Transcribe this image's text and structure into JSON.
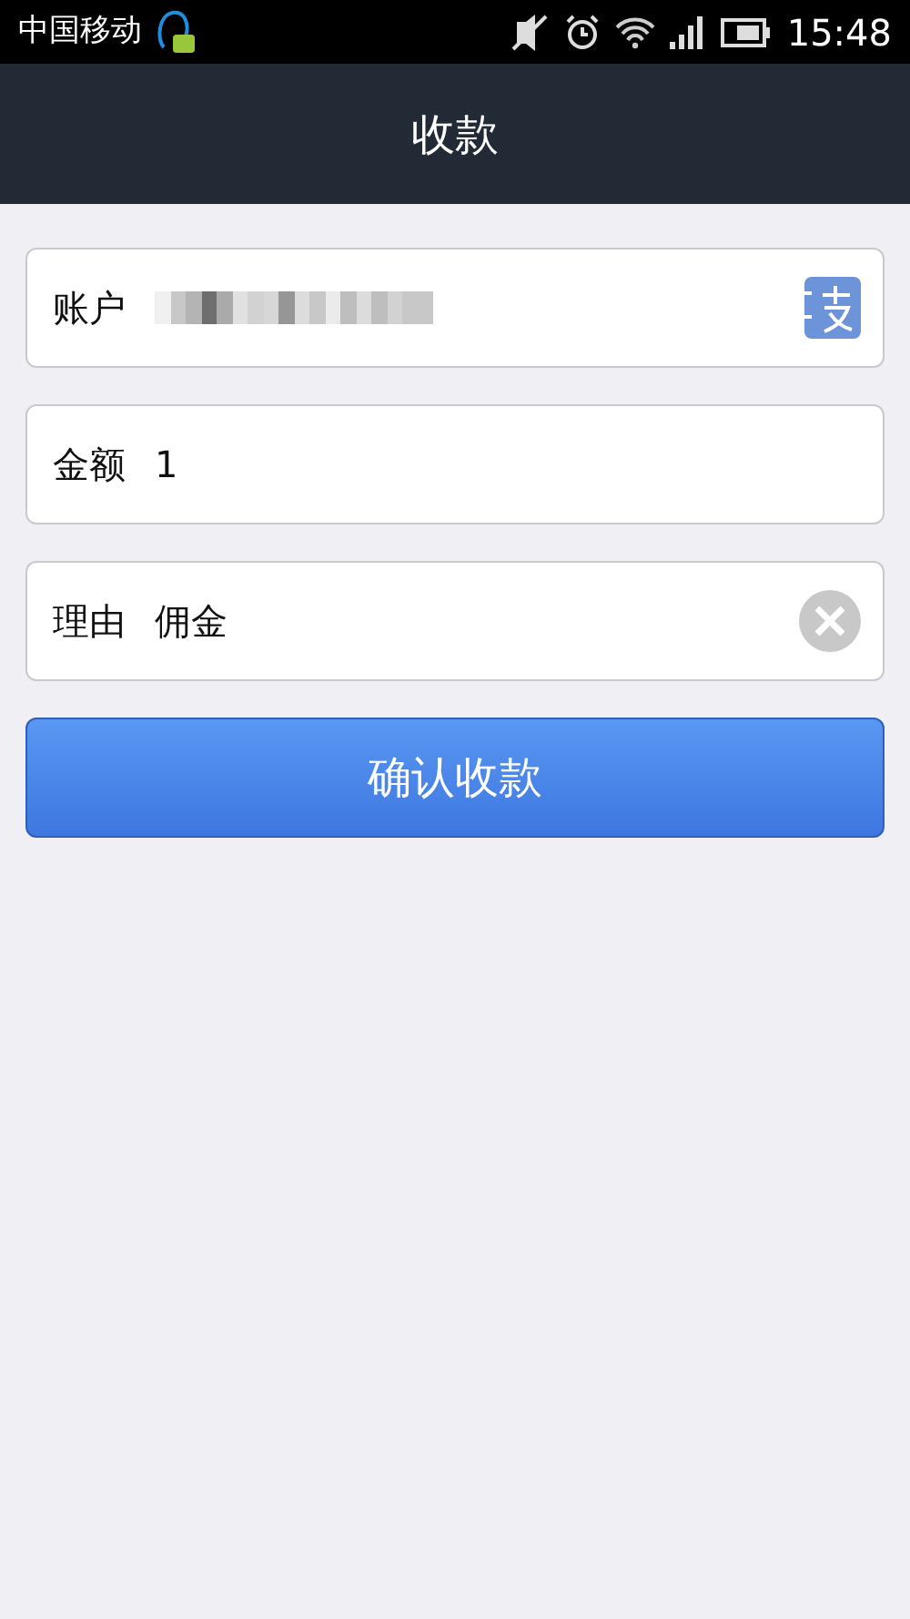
{
  "status_bar": {
    "carrier": "中国移动",
    "time": "15:48"
  },
  "header": {
    "title": "收款"
  },
  "fields": [
    {
      "kind": "picker",
      "label": "账户",
      "redacted": true
    },
    {
      "kind": "plain",
      "label": "金额",
      "value": "1",
      "redacted": false
    },
    {
      "kind": "clearable",
      "label": "理由",
      "value": "佣金",
      "redacted": false
    }
  ],
  "submit_button": "确认收款"
}
